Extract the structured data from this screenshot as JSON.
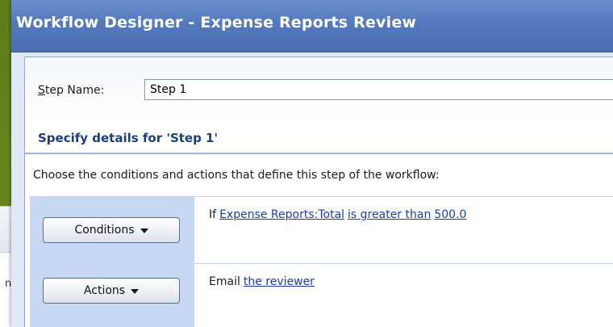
{
  "window": {
    "title": "Workflow Designer - Expense Reports Review"
  },
  "background_window": {
    "partial_text": "n"
  },
  "step": {
    "label_accesskey": "S",
    "label_rest": "tep Name:",
    "value": "Step 1"
  },
  "section": {
    "title": "Specify details for 'Step 1'"
  },
  "instructions": "Choose the conditions and actions that define this step of the workflow:",
  "conditions": {
    "button_label": "Conditions",
    "prefix": "If",
    "links": [
      "Expense Reports:Total",
      "is greater than",
      "500.0"
    ]
  },
  "actions": {
    "button_label": "Actions",
    "prefix": "Email",
    "links": [
      "the reviewer"
    ]
  },
  "icons": {
    "dropdown": "caret-down-icon"
  },
  "colors": {
    "title_bar": "#5479bd",
    "section_title": "#1b3f7d",
    "rule_panel": "#c7d8f3",
    "link": "#1c3bb4"
  }
}
